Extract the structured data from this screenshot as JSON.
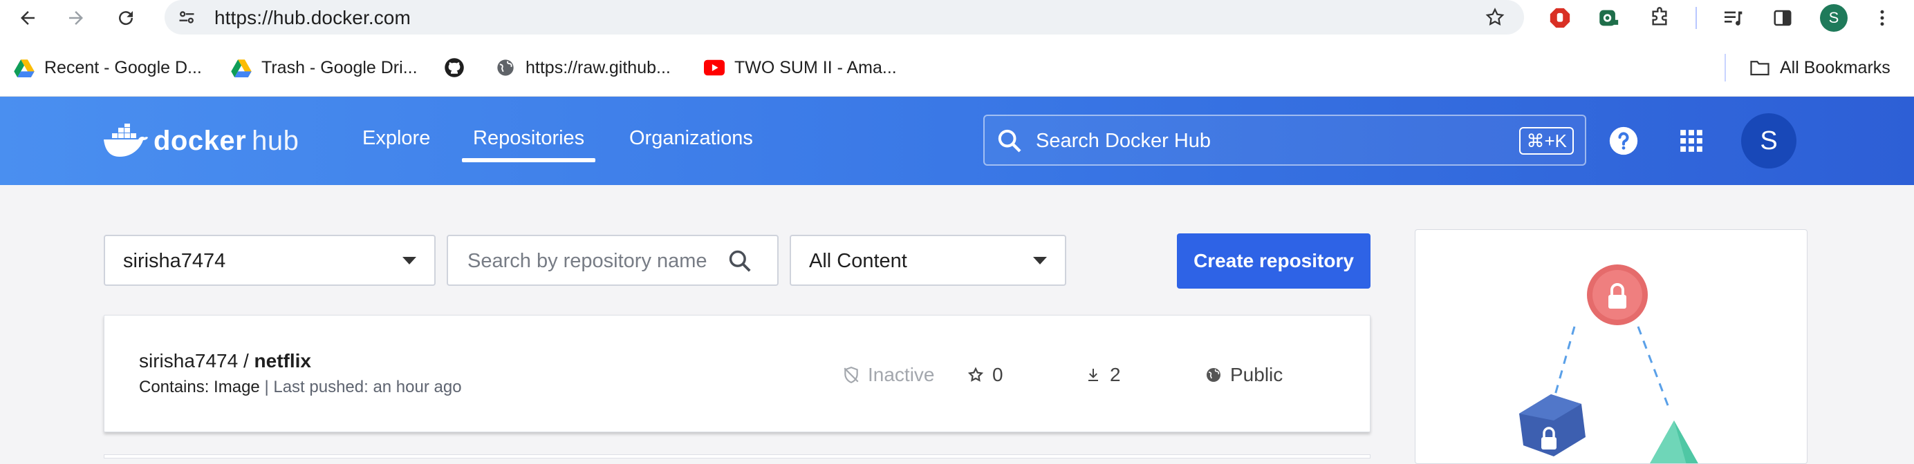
{
  "browser": {
    "url": "https://hub.docker.com",
    "profile_initial": "S",
    "icons": [
      "back-icon",
      "forward-icon",
      "reload-icon",
      "site-settings-icon",
      "bookmark-star-icon",
      "adblock-extension-icon",
      "screen-capture-extension-icon",
      "extensions-puzzle-icon",
      "reading-list-icon",
      "side-panel-icon",
      "more-options-icon"
    ]
  },
  "bookmarks": {
    "items": [
      {
        "label": "Recent - Google D...",
        "icon": "google-drive-icon"
      },
      {
        "label": "Trash - Google Dri...",
        "icon": "google-drive-icon"
      },
      {
        "label": "",
        "icon": "github-icon"
      },
      {
        "label": "https://raw.github...",
        "icon": "globe-icon"
      },
      {
        "label": "TWO SUM II - Ama...",
        "icon": "youtube-icon"
      }
    ],
    "all_bookmarks": "All Bookmarks"
  },
  "header": {
    "logo_word1": "docker",
    "logo_word2": "hub",
    "nav": [
      {
        "label": "Explore",
        "active": false
      },
      {
        "label": "Repositories",
        "active": true
      },
      {
        "label": "Organizations",
        "active": false
      }
    ],
    "search_placeholder": "Search Docker Hub",
    "search_shortcut": "⌘+K",
    "avatar_initial": "S",
    "brand_color": "#2e63e6"
  },
  "filters": {
    "namespace": "sirisha7474",
    "search_placeholder": "Search by repository name",
    "content_filter": "All Content",
    "create_label": "Create repository"
  },
  "repositories": [
    {
      "namespace": "sirisha7474",
      "separator": " / ",
      "name": "netflix",
      "contains_label": "Contains: Image",
      "pushed": "| Last pushed: an hour ago",
      "status": "Inactive",
      "stars": "0",
      "pulls": "2",
      "visibility": "Public"
    }
  ]
}
